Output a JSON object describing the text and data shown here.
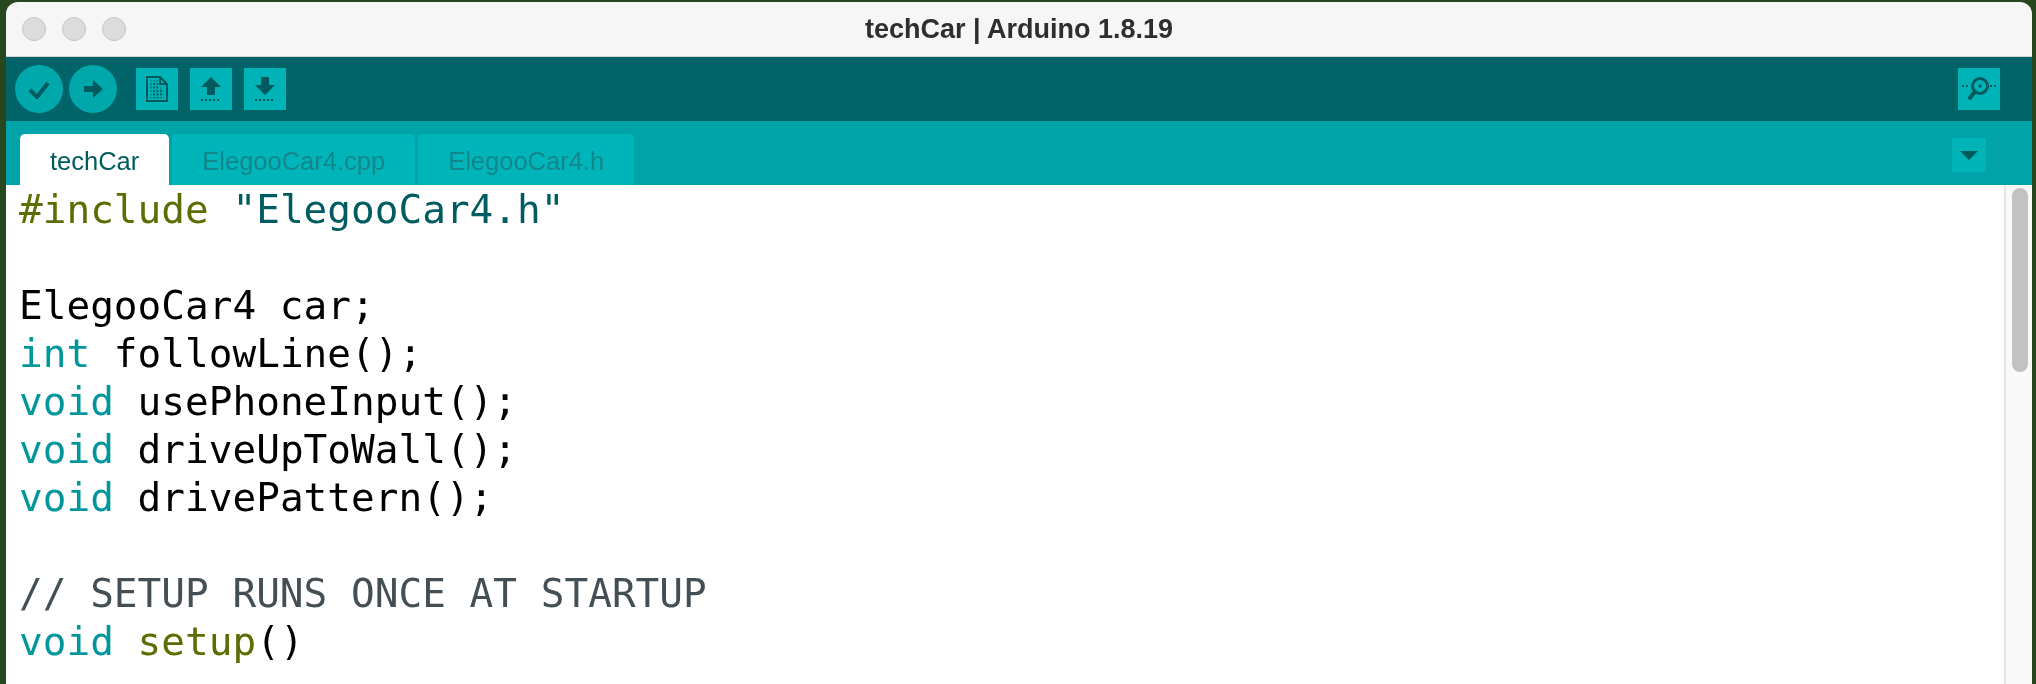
{
  "window": {
    "title": "techCar | Arduino 1.8.19"
  },
  "tabs": [
    {
      "label": "techCar",
      "selected": true
    },
    {
      "label": "ElegooCar4.cpp",
      "selected": false
    },
    {
      "label": "ElegooCar4.h",
      "selected": false
    }
  ],
  "editor": {
    "lines": [
      {
        "kind": "code",
        "tokens": [
          {
            "kind": "directive",
            "text": "#include"
          },
          {
            "kind": "string",
            "text": " \"ElegooCar4.h\""
          }
        ]
      },
      {
        "kind": "blank"
      },
      {
        "kind": "code",
        "tokens": [
          {
            "kind": "plain",
            "text": "ElegooCar4 car;"
          }
        ]
      },
      {
        "kind": "code",
        "tokens": [
          {
            "kind": "keyword",
            "text": "int"
          },
          {
            "kind": "plain",
            "text": " followLine();"
          }
        ]
      },
      {
        "kind": "code",
        "tokens": [
          {
            "kind": "keyword",
            "text": "void"
          },
          {
            "kind": "plain",
            "text": " usePhoneInput();"
          }
        ]
      },
      {
        "kind": "code",
        "tokens": [
          {
            "kind": "keyword",
            "text": "void"
          },
          {
            "kind": "plain",
            "text": " driveUpToWall();"
          }
        ]
      },
      {
        "kind": "code",
        "tokens": [
          {
            "kind": "keyword",
            "text": "void"
          },
          {
            "kind": "plain",
            "text": " drivePattern();"
          }
        ]
      },
      {
        "kind": "blank"
      },
      {
        "kind": "code",
        "tokens": [
          {
            "kind": "comment",
            "text": "// SETUP RUNS ONCE AT STARTUP"
          }
        ]
      },
      {
        "kind": "code",
        "tokens": [
          {
            "kind": "keyword",
            "text": "void"
          },
          {
            "kind": "function",
            "text": " setup"
          },
          {
            "kind": "plain",
            "text": "()"
          }
        ]
      }
    ]
  }
}
